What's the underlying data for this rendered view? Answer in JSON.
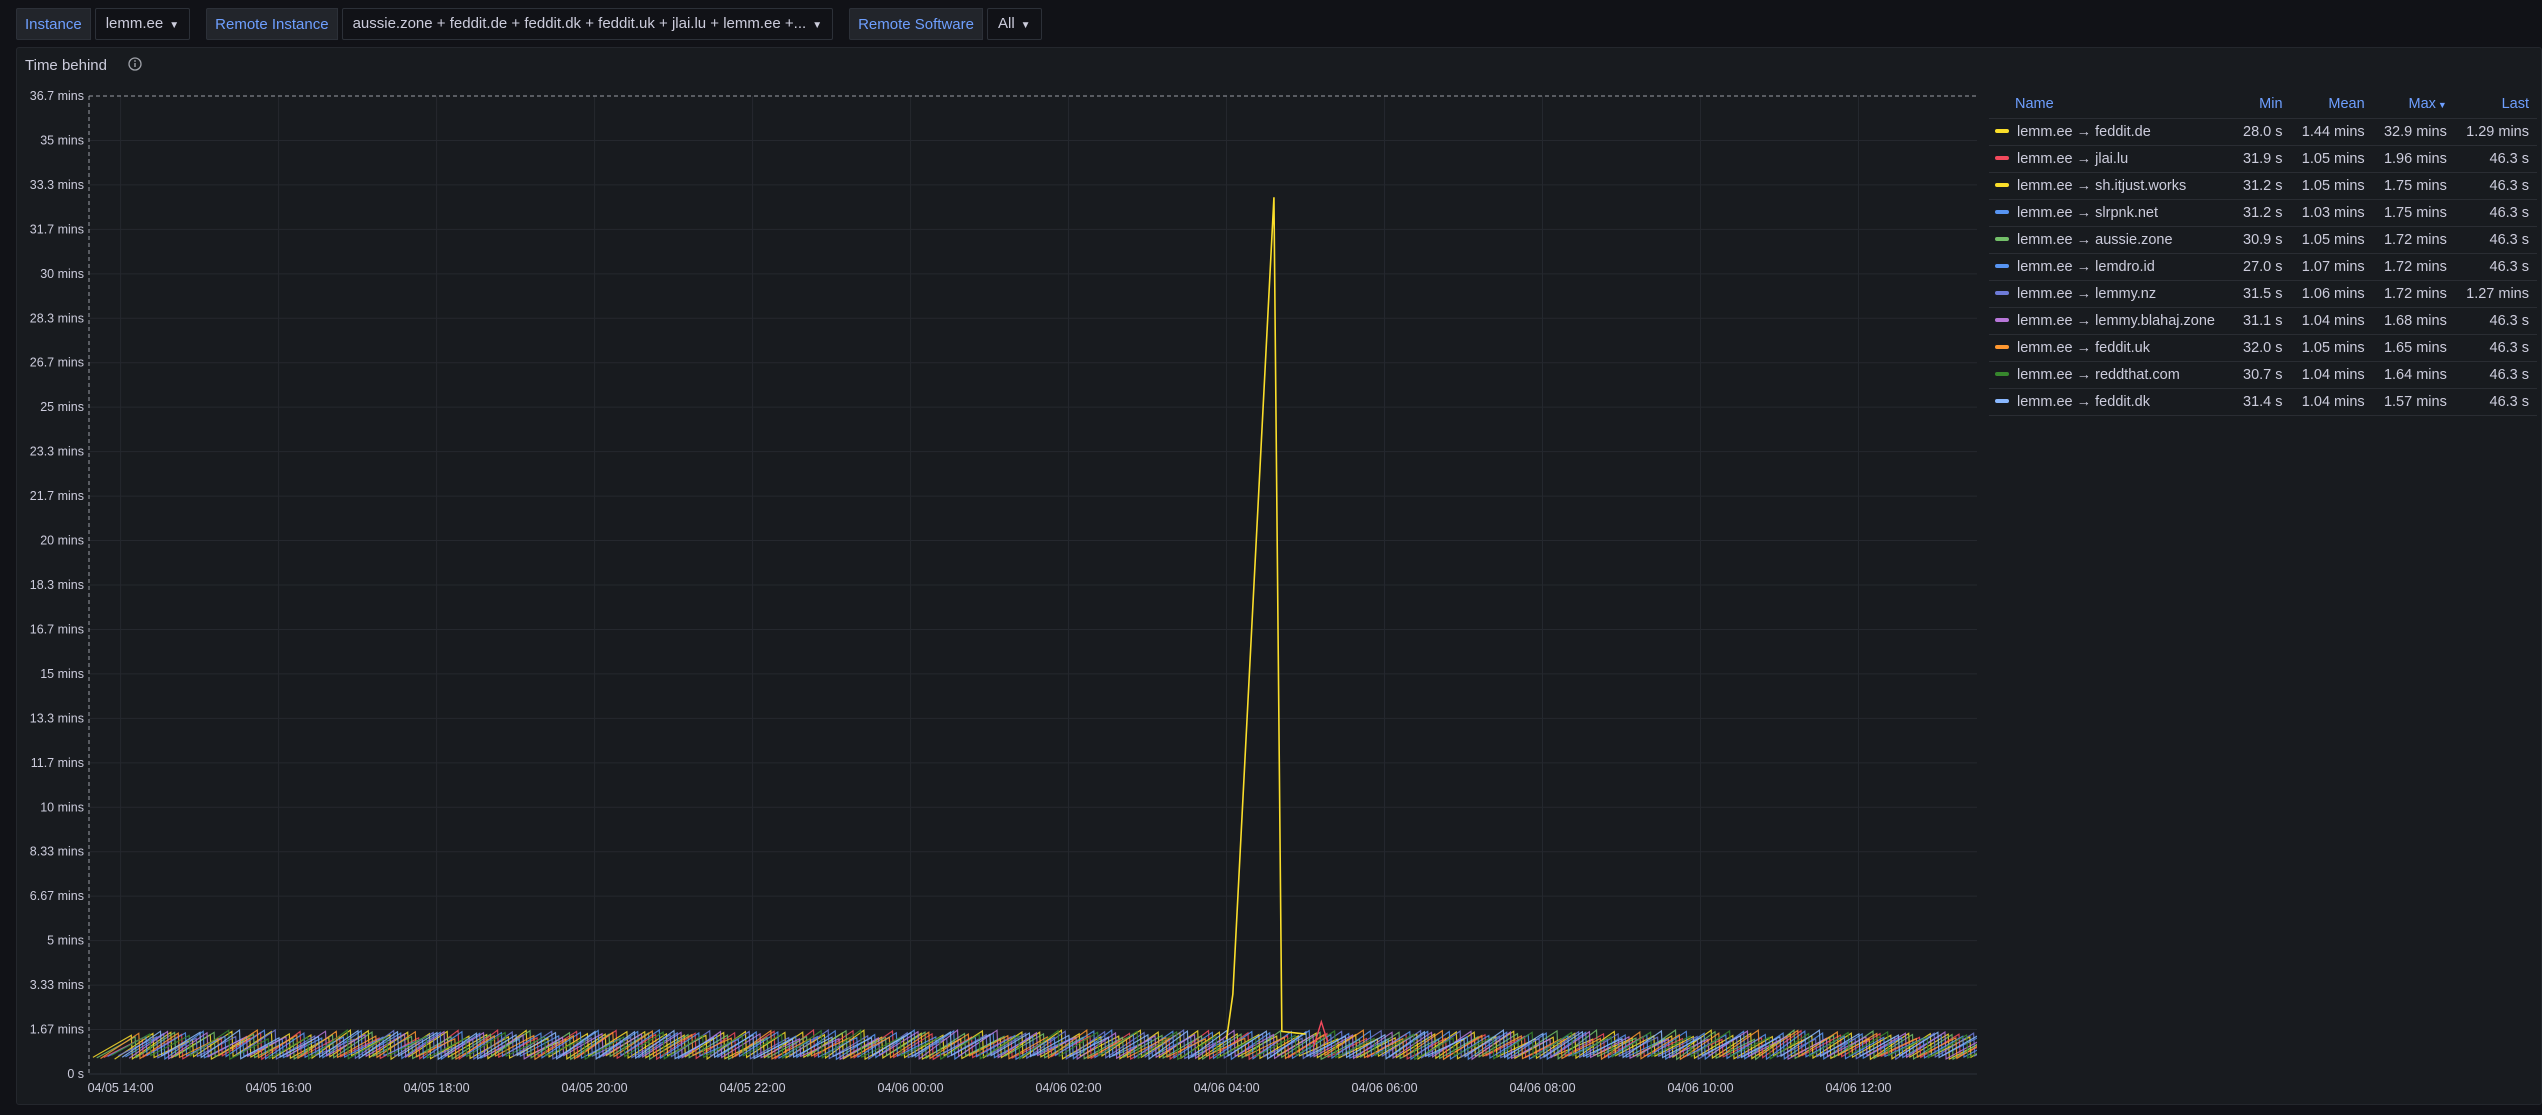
{
  "variables": [
    {
      "label": "Instance",
      "value": "lemm.ee"
    },
    {
      "label": "Remote Instance",
      "value": "aussie.zone + feddit.de + feddit.dk + feddit.uk + jlai.lu + lemm.ee +..."
    },
    {
      "label": "Remote Software",
      "value": "All"
    }
  ],
  "panel": {
    "title": "Time behind",
    "info_icon": "info-icon"
  },
  "legend": {
    "columns": {
      "name": "Name",
      "min": "Min",
      "mean": "Mean",
      "max": "Max",
      "last": "Last"
    },
    "sort_column": "max",
    "rows": [
      {
        "name": "lemm.ee → feddit.de",
        "color": "#fade2a",
        "min": "28.0 s",
        "mean": "1.44 mins",
        "max": "32.9 mins",
        "last": "1.29 mins"
      },
      {
        "name": "lemm.ee → jlai.lu",
        "color": "#f2495c",
        "min": "31.9 s",
        "mean": "1.05 mins",
        "max": "1.96 mins",
        "last": "46.3 s"
      },
      {
        "name": "lemm.ee → sh.itjust.works",
        "color": "#fade2a",
        "min": "31.2 s",
        "mean": "1.05 mins",
        "max": "1.75 mins",
        "last": "46.3 s"
      },
      {
        "name": "lemm.ee → slrpnk.net",
        "color": "#5794f2",
        "min": "31.2 s",
        "mean": "1.03 mins",
        "max": "1.75 mins",
        "last": "46.3 s"
      },
      {
        "name": "lemm.ee → aussie.zone",
        "color": "#73bf69",
        "min": "30.9 s",
        "mean": "1.05 mins",
        "max": "1.72 mins",
        "last": "46.3 s"
      },
      {
        "name": "lemm.ee → lemdro.id",
        "color": "#5794f2",
        "min": "27.0 s",
        "mean": "1.07 mins",
        "max": "1.72 mins",
        "last": "46.3 s"
      },
      {
        "name": "lemm.ee → lemmy.nz",
        "color": "#6e7bd8",
        "min": "31.5 s",
        "mean": "1.06 mins",
        "max": "1.72 mins",
        "last": "1.27 mins"
      },
      {
        "name": "lemm.ee → lemmy.blahaj.zone",
        "color": "#b877d9",
        "min": "31.1 s",
        "mean": "1.04 mins",
        "max": "1.68 mins",
        "last": "46.3 s"
      },
      {
        "name": "lemm.ee → feddit.uk",
        "color": "#ff9830",
        "min": "32.0 s",
        "mean": "1.05 mins",
        "max": "1.65 mins",
        "last": "46.3 s"
      },
      {
        "name": "lemm.ee → reddthat.com",
        "color": "#37872d",
        "min": "30.7 s",
        "mean": "1.04 mins",
        "max": "1.64 mins",
        "last": "46.3 s"
      },
      {
        "name": "lemm.ee → feddit.dk",
        "color": "#8ab8ff",
        "min": "31.4 s",
        "mean": "1.04 mins",
        "max": "1.57 mins",
        "last": "46.3 s"
      }
    ]
  },
  "chart_data": {
    "type": "line",
    "title": "Time behind",
    "y_unit": "mins",
    "ylim": [
      0,
      36.7
    ],
    "y_ticks": [
      "0 s",
      "1.67 mins",
      "3.33 mins",
      "5 mins",
      "6.67 mins",
      "8.33 mins",
      "10 mins",
      "11.7 mins",
      "13.3 mins",
      "15 mins",
      "16.7 mins",
      "18.3 mins",
      "20 mins",
      "21.7 mins",
      "23.3 mins",
      "25 mins",
      "26.7 mins",
      "28.3 mins",
      "30 mins",
      "31.7 mins",
      "33.3 mins",
      "35 mins",
      "36.7 mins"
    ],
    "x_ticks": [
      "04/05 14:00",
      "04/05 16:00",
      "04/05 18:00",
      "04/05 20:00",
      "04/05 22:00",
      "04/06 00:00",
      "04/06 02:00",
      "04/06 04:00",
      "04/06 06:00",
      "04/06 08:00",
      "04/06 10:00",
      "04/06 12:00"
    ],
    "x_range_hours": [
      13.6,
      37.5
    ],
    "threshold_line": 36.7,
    "grid": true,
    "legend_placement": "right",
    "spike": {
      "series": "lemm.ee → feddit.de",
      "start_hour": 28.0,
      "peak_hour": 28.6,
      "end_hour": 28.7,
      "peak_value": 32.9
    },
    "small_spike": {
      "series": "lemm.ee → jlai.lu",
      "hour": 29.2,
      "value": 1.96
    },
    "sawtooth": {
      "base": 0.55,
      "peak": 1.65,
      "period_hours": 0.5
    }
  }
}
